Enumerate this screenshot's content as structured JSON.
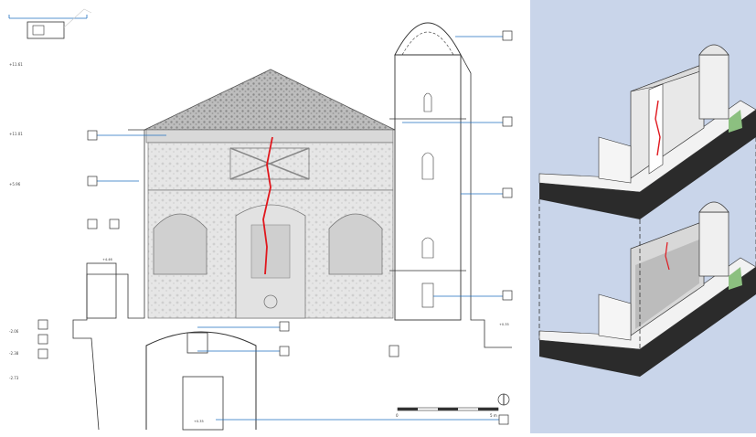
{
  "levels": [
    {
      "label": "+11.61"
    },
    {
      "label": "+11.01"
    },
    {
      "label": "+5.96"
    },
    {
      "label": "-2.06"
    },
    {
      "label": "-2.38"
    },
    {
      "label": "-2.73"
    }
  ],
  "dimension_labels": {
    "stair_top": "+4.46",
    "tower_base": "+0.35",
    "plan_bottom": "+0.35"
  },
  "scale_bar": {
    "zero": "0",
    "max": "5 m"
  },
  "colors": {
    "crack": "#e0161c",
    "callout": "#1f6fbf",
    "axo_bg": "#c9d5ea",
    "ground": "#2b2b2b",
    "grass": "#8cc080"
  }
}
